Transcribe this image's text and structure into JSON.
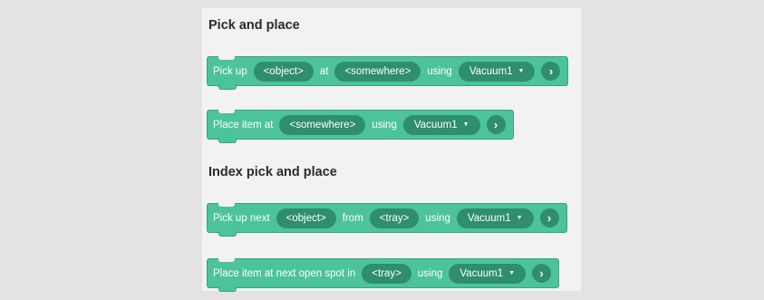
{
  "sections": [
    {
      "title": "Pick and place",
      "blocks": [
        {
          "parts": [
            {
              "kind": "text",
              "value": "Pick up"
            },
            {
              "kind": "pill",
              "value": "<object>"
            },
            {
              "kind": "text",
              "value": "at"
            },
            {
              "kind": "pill",
              "value": "<somewhere>"
            },
            {
              "kind": "text",
              "value": "using"
            },
            {
              "kind": "dropdown",
              "value": "Vacuum1"
            }
          ],
          "action_icon": "chevron-right-icon"
        },
        {
          "parts": [
            {
              "kind": "text",
              "value": "Place item at"
            },
            {
              "kind": "pill",
              "value": "<somewhere>"
            },
            {
              "kind": "text",
              "value": "using"
            },
            {
              "kind": "dropdown",
              "value": "Vacuum1"
            }
          ],
          "action_icon": "chevron-right-icon"
        }
      ]
    },
    {
      "title": "Index pick and place",
      "blocks": [
        {
          "parts": [
            {
              "kind": "text",
              "value": "Pick up next"
            },
            {
              "kind": "pill",
              "value": "<object>"
            },
            {
              "kind": "text",
              "value": "from"
            },
            {
              "kind": "pill",
              "value": "<tray>"
            },
            {
              "kind": "text",
              "value": "using"
            },
            {
              "kind": "dropdown",
              "value": "Vacuum1"
            }
          ],
          "action_icon": "chevron-right-icon"
        },
        {
          "parts": [
            {
              "kind": "text",
              "value": "Place item at next open spot in"
            },
            {
              "kind": "pill",
              "value": "<tray>"
            },
            {
              "kind": "text",
              "value": "using"
            },
            {
              "kind": "dropdown",
              "value": "Vacuum1"
            }
          ],
          "action_icon": "chevron-right-icon"
        }
      ]
    }
  ],
  "colors": {
    "block": "#4dc39b",
    "pill": "#2f8e6b",
    "panel": "#f2f2f2",
    "background": "#e3e3e3"
  }
}
